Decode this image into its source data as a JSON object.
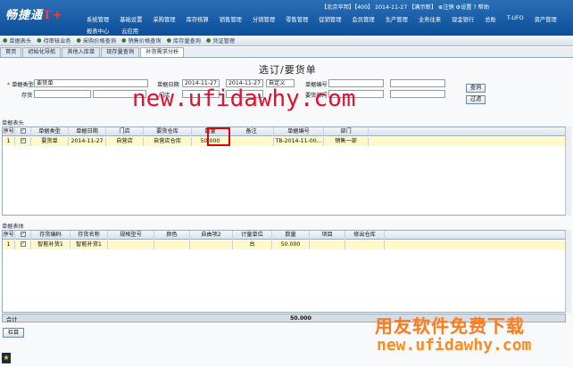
{
  "header": {
    "logo_main": "畅捷通",
    "logo_suffix": "T+",
    "info_text": "【北京华邦】【400】 2014-11-27 【满示新】 ⊕注销 ⚙设置 ? 帮助",
    "menu_row1": [
      "系统管理",
      "基础设置",
      "采购管理",
      "库存核算",
      "销售管理",
      "分销管理",
      "零售管理",
      "促销管理",
      "会员管理",
      "生产管理",
      "业务往来",
      "现金银行",
      "总账",
      "T-UFO",
      "资产管理"
    ],
    "menu_row2": [
      "报表中心",
      "云应用"
    ]
  },
  "subbar": [
    "单据表头",
    "待审核业务",
    "采购价格查询",
    "销售价格查询",
    "库存量查询",
    "凭证管理"
  ],
  "tabs": [
    "首页",
    "初始化导航",
    "其他入库单",
    "现存量查询",
    "补货需求分析"
  ],
  "form": {
    "title": "选订/要货单",
    "doc_type_label": "单据类型",
    "doc_type_value": "要货单",
    "date_label": "单据日期",
    "date_from": "2014-11-27",
    "date_to": "2014-11-27",
    "date_mode": "自定义",
    "doc_no_label": "单据编号",
    "stock_label": "存货",
    "store_label": "门店",
    "dept_label": "要货部门",
    "query_button": "查询",
    "filter_button": "过滤"
  },
  "watermark_top": "new.ufidawhy.com",
  "header_section": {
    "label": "单据表头",
    "columns": [
      "序号",
      "",
      "单据类型",
      "单据日期",
      "门店",
      "要货仓库",
      "数量",
      "备注",
      "单据编号",
      "部门"
    ],
    "rows": [
      [
        "1",
        "✓",
        "要货单",
        "2014-11-27",
        "自营店",
        "自营店仓库",
        "50.000",
        "",
        "TB-2014-11-00...",
        "销售一部"
      ]
    ]
  },
  "body_section": {
    "label": "单据表体",
    "columns": [
      "序号",
      "",
      "存货编码",
      "存货名称",
      "规格型号",
      "颜色",
      "自由项2",
      "计量单位",
      "数量",
      "项目",
      "修出仓库"
    ],
    "rows": [
      [
        "1",
        "✓",
        "智能补货1",
        "智能补货1",
        "",
        "",
        "",
        "台",
        "50.000",
        "",
        ""
      ]
    ]
  },
  "total": {
    "label": "合计",
    "value": "50.000"
  },
  "back_button": "栏目",
  "watermark_cn": "用友软件免费下载",
  "watermark_bottom": "new.ufidawhy.com"
}
